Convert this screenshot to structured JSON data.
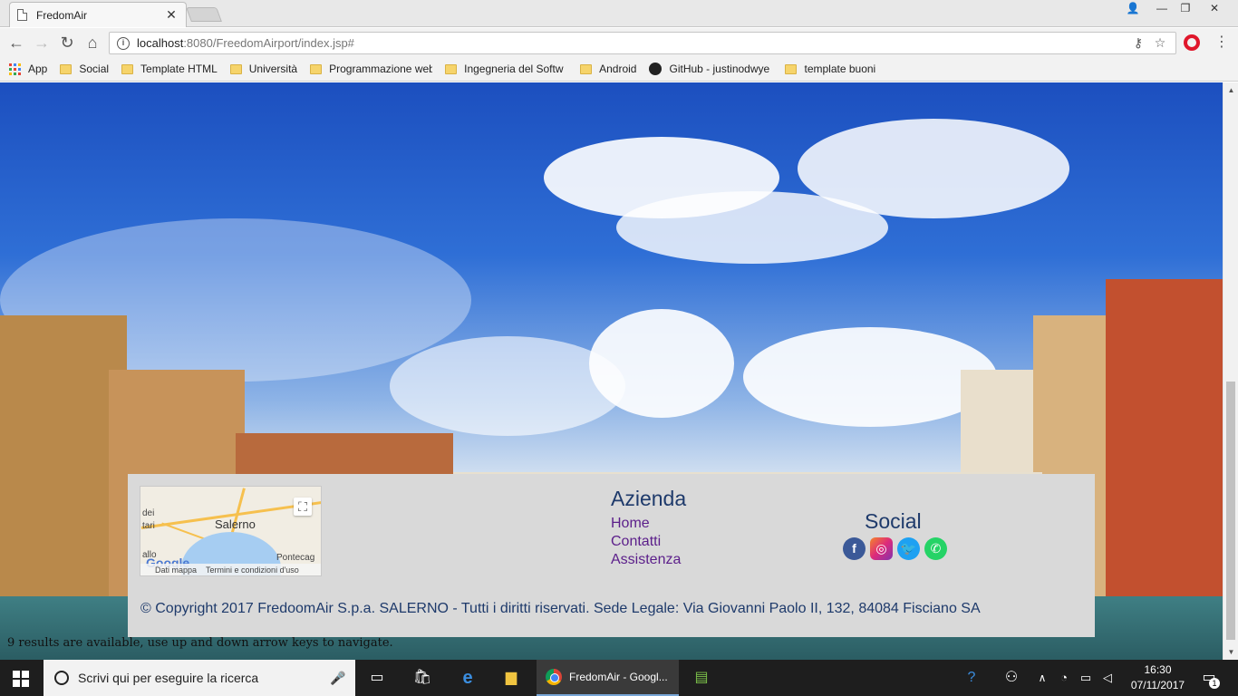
{
  "browser": {
    "tab_title": "FredomAir",
    "url_host": "localhost",
    "url_rest": ":8080/FreedomAirport/index.jsp#",
    "bookmarks": [
      {
        "label": "App",
        "type": "apps"
      },
      {
        "label": "Social",
        "type": "folder"
      },
      {
        "label": "Template HTML",
        "type": "folder"
      },
      {
        "label": "Università",
        "type": "folder"
      },
      {
        "label": "Programmazione web",
        "type": "folder"
      },
      {
        "label": "Ingegneria del Softw",
        "type": "folder"
      },
      {
        "label": "Android",
        "type": "folder"
      },
      {
        "label": "GitHub - justinodwye",
        "type": "github"
      },
      {
        "label": "template buoni",
        "type": "folder"
      }
    ]
  },
  "footer": {
    "map": {
      "city": "Salerno",
      "label_left1": "dei",
      "label_left2": "tari",
      "label_right": "Pontecag",
      "label_left3": "allo",
      "google": "Google",
      "data_link": "Dati mappa",
      "terms_link": "Termini e condizioni d'uso"
    },
    "company_title": "Azienda",
    "links": [
      "Home",
      "Contatti",
      "Assistenza"
    ],
    "social_title": "Social",
    "social_icons": [
      "facebook-icon",
      "instagram-icon",
      "twitter-icon",
      "whatsapp-icon"
    ],
    "copyright": "© Copyright 2017 FredoomAir S.p.a. SALERNO - Tutti i diritti riservati. Sede Legale: Via Giovanni Paolo II, 132, 84084 Fisciano SA"
  },
  "live_region": "9 results are available, use up and down arrow keys to navigate.",
  "taskbar": {
    "search_placeholder": "Scrivi qui per eseguire la ricerca",
    "chrome_label": "FredomAir - Googl...",
    "time": "16:30",
    "date": "07/11/2017",
    "notif_count": "1"
  },
  "colors": {
    "footer_bg": "#d9d9d9",
    "heading": "#1e3a6b",
    "link": "#5b1e8a",
    "facebook": "#3b5998",
    "twitter": "#1da1f2",
    "whatsapp": "#25d366"
  }
}
